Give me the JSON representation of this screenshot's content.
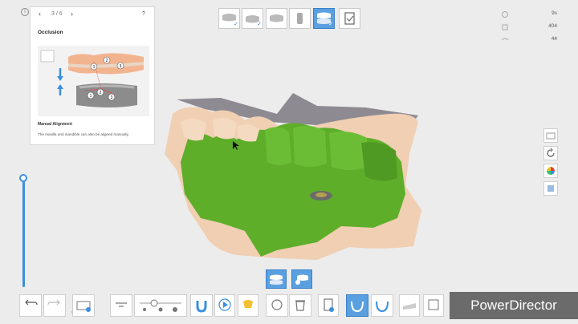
{
  "help": {
    "step": "3 / 6",
    "prev_icon": "chevron-left-icon",
    "next_icon": "chevron-right-icon",
    "help_icon": "?",
    "title": "Occlusion",
    "subtitle": "Manual Alignment",
    "description": "The maxilla and mandible can also be aligned manually.",
    "tooth_labels": [
      "1",
      "2",
      "3",
      "1",
      "2",
      "3"
    ]
  },
  "info_label": "i",
  "stats": [
    {
      "icon": "timer-icon",
      "value": "9s"
    },
    {
      "icon": "layers-icon",
      "value": "404"
    },
    {
      "icon": "link-icon",
      "value": "44"
    }
  ],
  "top_steps": [
    {
      "name": "upper-jaw-step",
      "done": true
    },
    {
      "name": "lower-jaw-step",
      "done": true
    },
    {
      "name": "bite-step",
      "done": false
    },
    {
      "name": "scan-body-step",
      "done": false
    },
    {
      "name": "occlusion-step",
      "done": true,
      "active": true
    },
    {
      "name": "complete-step",
      "done": false
    }
  ],
  "bottom": {
    "undo_label": "Undo",
    "redo_label": "Redo"
  },
  "watermark": "PowerDirector",
  "colors": {
    "accent": "#3b8fe0",
    "scan_green": "#5fae2a",
    "tooth_beige": "#f0cfb3",
    "gum_grey": "#8e8a92"
  }
}
